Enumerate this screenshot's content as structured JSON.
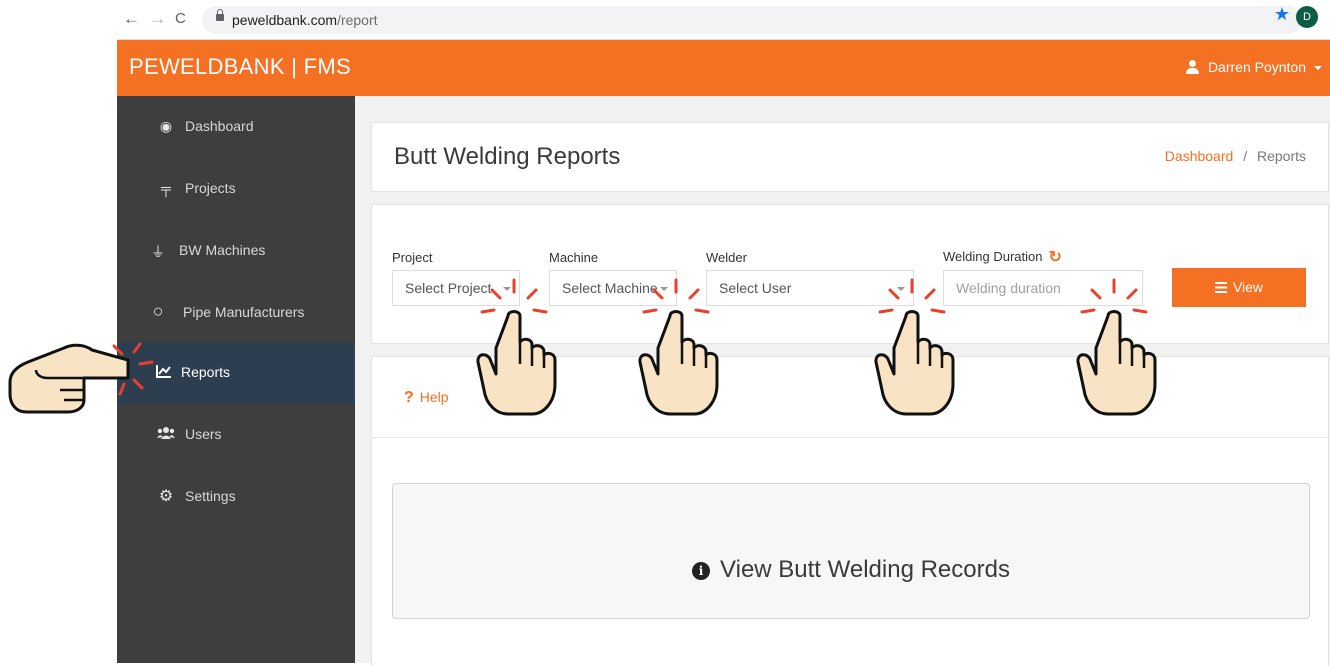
{
  "browser": {
    "domain": "peweldbank.com",
    "path": "/report",
    "profile_initial": "D",
    "back_glyph": "←",
    "forward_glyph": "→",
    "reload_glyph": "C",
    "star_glyph": "★"
  },
  "header": {
    "brand": "PEWELDBANK | FMS",
    "user_name": "Darren Poynton"
  },
  "sidebar": {
    "items": [
      {
        "label": "Dashboard",
        "icon": "tachometer-icon",
        "glyph": "◉"
      },
      {
        "label": "Projects",
        "icon": "sitemap-icon",
        "glyph": "╤"
      },
      {
        "label": "BW Machines",
        "icon": "plug-icon",
        "glyph": "⏚"
      },
      {
        "label": "Pipe Manufacturers",
        "icon": "circle-outline-icon",
        "glyph": "○"
      },
      {
        "label": "Reports",
        "icon": "line-chart-icon",
        "glyph": "📈",
        "active": true
      },
      {
        "label": "Users",
        "icon": "users-icon",
        "glyph": "👥"
      },
      {
        "label": "Settings",
        "icon": "cogs-icon",
        "glyph": "⚙"
      }
    ]
  },
  "page": {
    "title": "Butt Welding Reports",
    "breadcrumb": {
      "home": "Dashboard",
      "separator": "/",
      "current": "Reports"
    }
  },
  "filters": {
    "project": {
      "label": "Project",
      "placeholder": "Select Project"
    },
    "machine": {
      "label": "Machine",
      "placeholder": "Select Machine"
    },
    "welder": {
      "label": "Welder",
      "placeholder": "Select User"
    },
    "duration": {
      "label": "Welding Duration",
      "placeholder": "Welding duration"
    },
    "view_button": "View",
    "refresh_glyph": "↻"
  },
  "help": {
    "label": "Help",
    "glyph": "?"
  },
  "records": {
    "text": "View Butt Welding Records",
    "info_glyph": "i"
  },
  "colors": {
    "accent": "#f47023",
    "sidebar": "#3e3e3e",
    "sidebar_active": "#2c3e50",
    "hand_fill": "#f8e3c4",
    "spark": "#e8402a"
  }
}
